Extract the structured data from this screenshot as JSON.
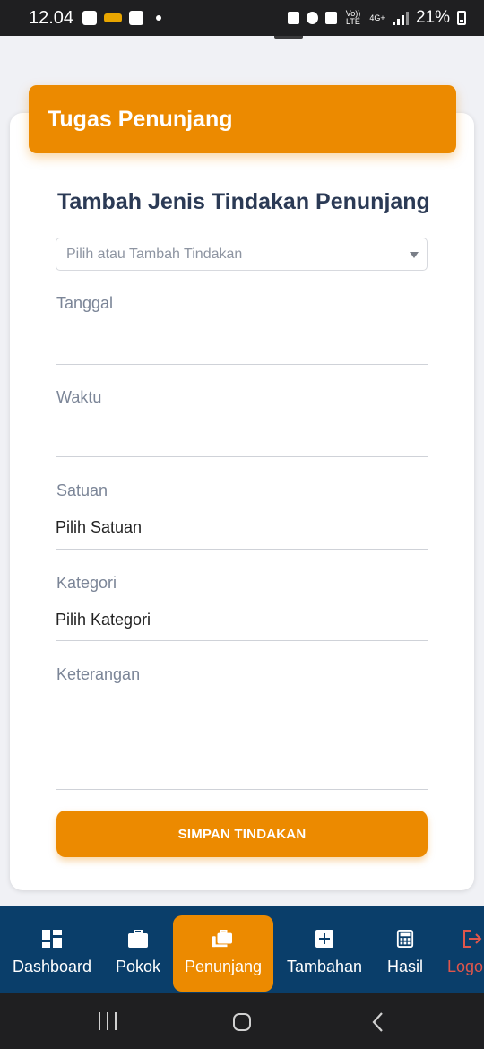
{
  "status_bar": {
    "time": "12.04",
    "network_label_1": "Vo)) LTE",
    "network_label_2": "4G+",
    "battery": "21%"
  },
  "header": {
    "title": "Tugas Penunjang"
  },
  "form": {
    "title": "Tambah Jenis Tindakan Penunjang",
    "action_select_placeholder": "Pilih atau Tambah Tindakan",
    "fields": [
      {
        "label": "Tanggal",
        "value": ""
      },
      {
        "label": "Waktu",
        "value": ""
      },
      {
        "label": "Satuan",
        "value": "Pilih Satuan"
      },
      {
        "label": "Kategori",
        "value": "Pilih Kategori"
      },
      {
        "label": "Keterangan",
        "value": ""
      }
    ],
    "submit_label": "SIMPAN TINDAKAN"
  },
  "bottom_nav": {
    "items": [
      {
        "label": "Dashboard",
        "icon": "dashboard-icon"
      },
      {
        "label": "Pokok",
        "icon": "briefcase-icon"
      },
      {
        "label": "Penunjang",
        "icon": "briefcases-icon",
        "active": true
      },
      {
        "label": "Tambahan",
        "icon": "plus-square-icon"
      },
      {
        "label": "Hasil",
        "icon": "calculator-icon"
      },
      {
        "label": "Logo",
        "icon": "logout-icon"
      }
    ]
  },
  "colors": {
    "accent": "#ec8a00",
    "nav_bg": "#0a3e6a",
    "title_text": "#2b3a55",
    "logout": "#e0564b"
  }
}
